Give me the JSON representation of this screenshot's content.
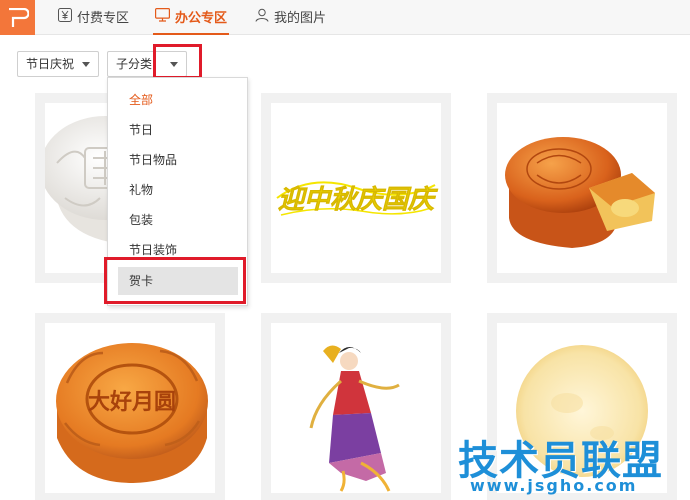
{
  "tabs": {
    "paid": "付费专区",
    "office": "办公专区",
    "mine": "我的图片"
  },
  "filters": {
    "festival_value": "节日庆祝",
    "subcategory_value": "子分类"
  },
  "dropdown": {
    "items": [
      "全部",
      "节日",
      "节日物品",
      "礼物",
      "包装",
      "节日装饰",
      "贺卡"
    ],
    "active_index": 0,
    "hover_index": 6
  },
  "cards": [
    {
      "image": "white-mooncake"
    },
    {
      "image": "festival-greeting-text",
      "text": "迎中秋庆国庆"
    },
    {
      "image": "sliced-mooncake"
    },
    {
      "image": "golden-mooncake",
      "text": "大好月圆"
    },
    {
      "image": "change-e-figure"
    },
    {
      "image": "full-moon"
    }
  ],
  "watermark": {
    "title": "技术员联盟",
    "url": "www.jsgho.com"
  },
  "colors": {
    "accent": "#e45a1a",
    "logo_bg": "#f3763a",
    "highlight": "#e01b2a",
    "watermark": "#1e8fd8"
  }
}
